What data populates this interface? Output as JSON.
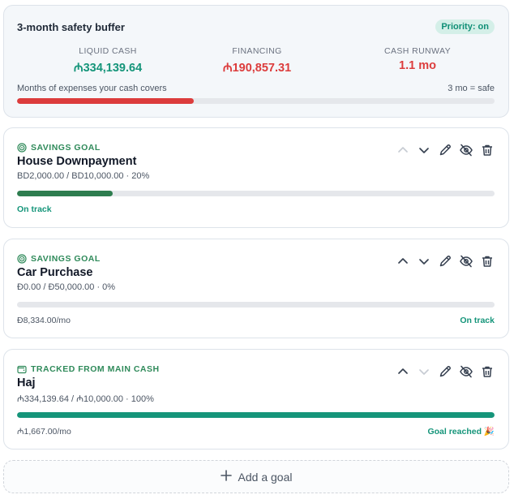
{
  "buffer": {
    "title": "3-month safety buffer",
    "priority_badge": "Priority: on",
    "stats": [
      {
        "label": "LIQUID CASH",
        "value": "334,139.64",
        "currency_symbol": "₼",
        "color": "#15957a"
      },
      {
        "label": "FINANCING",
        "value": "190,857.31",
        "currency_symbol": "₼",
        "color": "#dc3c3c"
      },
      {
        "label": "CASH RUNWAY",
        "value": "1.1 mo",
        "color": "#dc3c3c"
      }
    ],
    "caption": "Months of expenses your cash covers",
    "safe_label": "3 mo = safe",
    "progress": 0.37,
    "progress_color": "#dc3c3c"
  },
  "goals": [
    {
      "kicker": "SAVINGS GOAL",
      "kicker_icon": "target-icon",
      "title": "House Downpayment",
      "amount": "BD2,000.00 / BD10,000.00 · 20%",
      "progress": 0.2,
      "progress_color": "#2e7d4f",
      "footer_left": "On track",
      "footer_right": "",
      "up_enabled": false,
      "down_enabled": true
    },
    {
      "kicker": "SAVINGS GOAL",
      "kicker_icon": "target-icon",
      "title": "Car Purchase",
      "amount": "Ð0.00 / Ð50,000.00 · 0%",
      "progress": 0,
      "progress_color": "#2e7d4f",
      "footer_left": "Ð8,334.00/mo",
      "footer_right": "On track",
      "up_enabled": true,
      "down_enabled": true
    },
    {
      "kicker": "TRACKED FROM MAIN CASH",
      "kicker_icon": "wallet-icon",
      "title": "Haj",
      "amount": "₼334,139.64 / ₼10,000.00 · 100%",
      "progress": 1.0,
      "progress_color": "#15957a",
      "footer_left": "₼1,667.00/mo",
      "footer_right": "Goal reached 🎉",
      "up_enabled": true,
      "down_enabled": false
    }
  ],
  "add_goal_label": "Add a goal",
  "colors": {
    "accent_green": "#15957a",
    "alert_red": "#dc3c3c",
    "track_gray": "#e5e7eb"
  }
}
